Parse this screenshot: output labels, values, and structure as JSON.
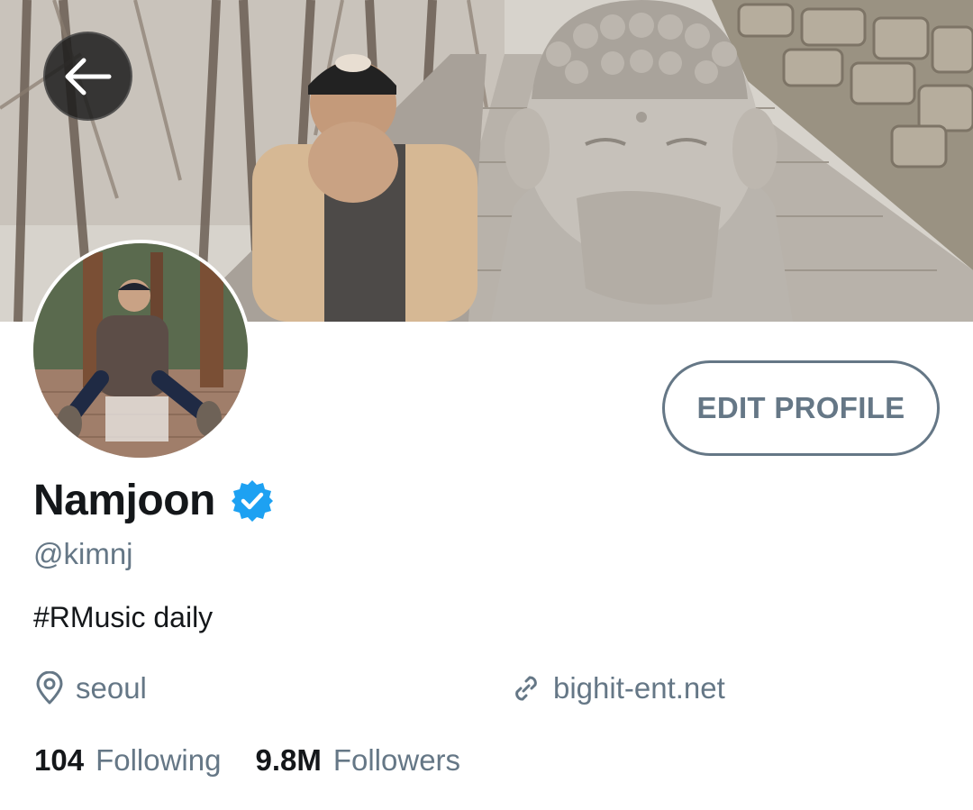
{
  "header": {
    "back_icon": "arrow-left-icon",
    "banner_image": "header-photo"
  },
  "profile": {
    "display_name": "Namjoon",
    "verified": true,
    "verified_color": "#1da1f2",
    "handle": "@kimnj",
    "bio": "#RMusic daily",
    "location": "seoul",
    "location_icon": "map-pin-icon",
    "website": "bighit-ent.net",
    "website_icon": "link-icon",
    "edit_button_label": "EDIT PROFILE"
  },
  "stats": {
    "following_count": "104",
    "following_label": "Following",
    "followers_count": "9.8M",
    "followers_label": "Followers"
  },
  "colors": {
    "primary_text": "#14171a",
    "secondary_text": "#657786",
    "accent": "#1da1f2"
  }
}
